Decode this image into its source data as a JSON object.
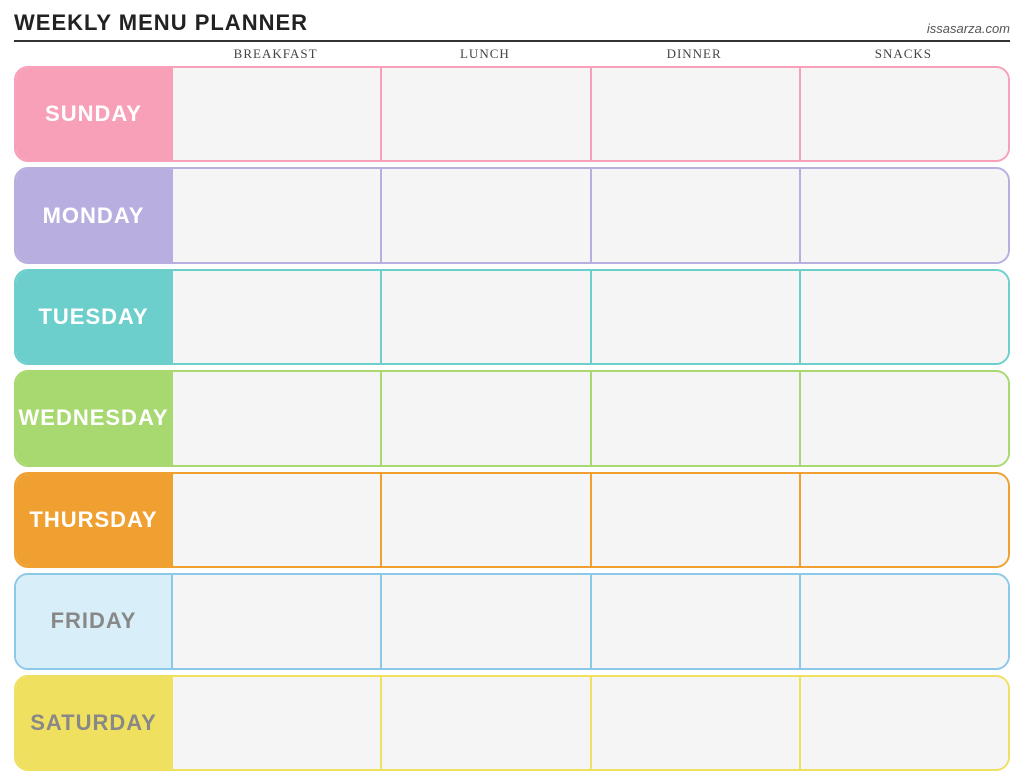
{
  "header": {
    "title": "Weekly Menu Planner",
    "website": "issasarza.com"
  },
  "columns": {
    "empty": "",
    "breakfast": "Breakfast",
    "lunch": "Lunch",
    "dinner": "Dinner",
    "snacks": "Snacks"
  },
  "days": [
    {
      "id": "sunday",
      "label": "Sunday",
      "class": "row-sunday"
    },
    {
      "id": "monday",
      "label": "Monday",
      "class": "row-monday"
    },
    {
      "id": "tuesday",
      "label": "Tuesday",
      "class": "row-tuesday"
    },
    {
      "id": "wednesday",
      "label": "Wednesday",
      "class": "row-wednesday"
    },
    {
      "id": "thursday",
      "label": "Thursday",
      "class": "row-thursday"
    },
    {
      "id": "friday",
      "label": "Friday",
      "class": "row-friday"
    },
    {
      "id": "saturday",
      "label": "Saturday",
      "class": "row-saturday"
    }
  ]
}
